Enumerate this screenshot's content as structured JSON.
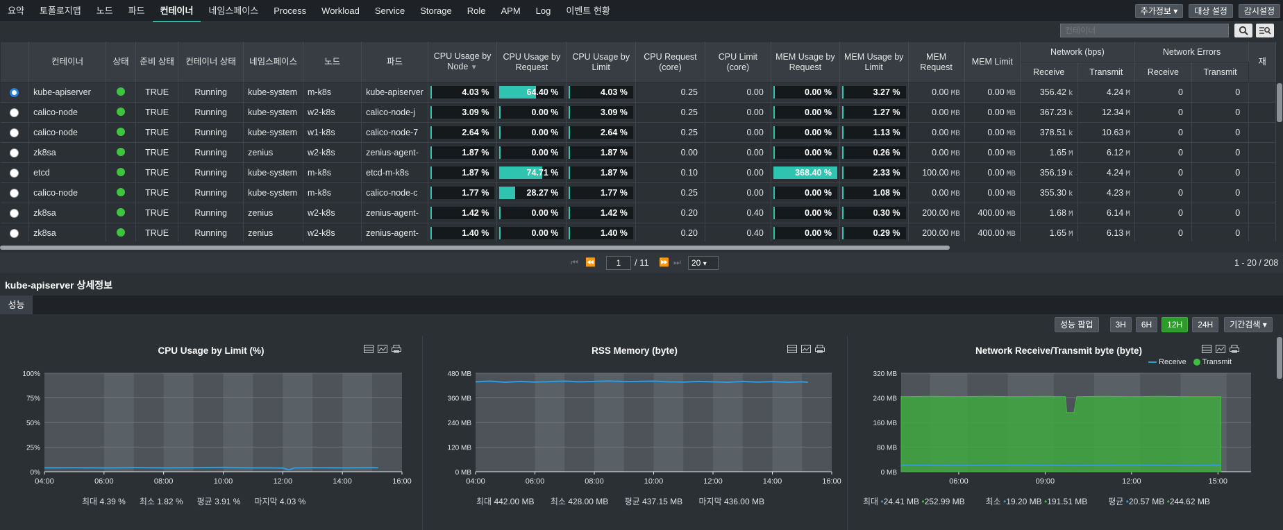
{
  "nav": {
    "tabs": [
      "요약",
      "토폴로지맵",
      "노드",
      "파드",
      "컨테이너",
      "네임스페이스",
      "Process",
      "Workload",
      "Service",
      "Storage",
      "Role",
      "APM",
      "Log",
      "이벤트 현황"
    ],
    "active": "컨테이너",
    "more_info": "추가정보",
    "target_settings": "대상 설정",
    "monitor_settings": "감시설정"
  },
  "search": {
    "placeholder": "컨테이너"
  },
  "table": {
    "headers": {
      "container": "컨테이너",
      "status": "상태",
      "ready": "준비 상태",
      "container_status": "컨테이너 상태",
      "namespace": "네임스페이스",
      "node": "노드",
      "pod": "파드",
      "cpu_node": "CPU Usage by Node",
      "cpu_req": "CPU Usage by Request",
      "cpu_limit": "CPU Usage by Limit",
      "cpu_request_core": "CPU Request (core)",
      "cpu_limit_core": "CPU Limit (core)",
      "mem_req": "MEM Usage by Request",
      "mem_limit": "MEM Usage by Limit",
      "mem_request": "MEM Request",
      "mem_limit2": "MEM Limit",
      "network": "Network (bps)",
      "network_errors": "Network Errors",
      "receive": "Receive",
      "transmit": "Transmit",
      "cut": "재"
    },
    "rows": [
      {
        "name": "kube-apiserver",
        "ready": "TRUE",
        "state": "Running",
        "ns": "kube-system",
        "node": "m-k8s",
        "pod": "kube-apiserver",
        "cpu_node": 4.03,
        "cpu_node_t": "4.03 %",
        "cpu_req": 64.4,
        "cpu_req_t": "64.40 %",
        "cpu_lim": 4.03,
        "cpu_lim_t": "4.03 %",
        "cpu_req_core": "0.25",
        "cpu_lim_core": "0.00",
        "mem_req": 0,
        "mem_req_t": "0.00 %",
        "mem_lim": 3.27,
        "mem_lim_t": "3.27 %",
        "mem_request": "0.00",
        "mem_limit": "0.00",
        "rx": "356.42",
        "rx_u": "k",
        "tx": "4.24",
        "tx_u": "M",
        "err_rx": "0",
        "err_tx": "0",
        "selected": true
      },
      {
        "name": "calico-node",
        "ready": "TRUE",
        "state": "Running",
        "ns": "kube-system",
        "node": "w2-k8s",
        "pod": "calico-node-j",
        "cpu_node": 3.09,
        "cpu_node_t": "3.09 %",
        "cpu_req": 0,
        "cpu_req_t": "0.00 %",
        "cpu_lim": 3.09,
        "cpu_lim_t": "3.09 %",
        "cpu_req_core": "0.25",
        "cpu_lim_core": "0.00",
        "mem_req": 0,
        "mem_req_t": "0.00 %",
        "mem_lim": 1.27,
        "mem_lim_t": "1.27 %",
        "mem_request": "0.00",
        "mem_limit": "0.00",
        "rx": "367.23",
        "rx_u": "k",
        "tx": "12.34",
        "tx_u": "M",
        "err_rx": "0",
        "err_tx": "0"
      },
      {
        "name": "calico-node",
        "ready": "TRUE",
        "state": "Running",
        "ns": "kube-system",
        "node": "w1-k8s",
        "pod": "calico-node-7",
        "cpu_node": 2.64,
        "cpu_node_t": "2.64 %",
        "cpu_req": 0,
        "cpu_req_t": "0.00 %",
        "cpu_lim": 2.64,
        "cpu_lim_t": "2.64 %",
        "cpu_req_core": "0.25",
        "cpu_lim_core": "0.00",
        "mem_req": 0,
        "mem_req_t": "0.00 %",
        "mem_lim": 1.13,
        "mem_lim_t": "1.13 %",
        "mem_request": "0.00",
        "mem_limit": "0.00",
        "rx": "378.51",
        "rx_u": "k",
        "tx": "10.63",
        "tx_u": "M",
        "err_rx": "0",
        "err_tx": "0"
      },
      {
        "name": "zk8sa",
        "ready": "TRUE",
        "state": "Running",
        "ns": "zenius",
        "node": "w2-k8s",
        "pod": "zenius-agent-",
        "cpu_node": 1.87,
        "cpu_node_t": "1.87 %",
        "cpu_req": 0,
        "cpu_req_t": "0.00 %",
        "cpu_lim": 1.87,
        "cpu_lim_t": "1.87 %",
        "cpu_req_core": "0.00",
        "cpu_lim_core": "0.00",
        "mem_req": 0,
        "mem_req_t": "0.00 %",
        "mem_lim": 0.26,
        "mem_lim_t": "0.26 %",
        "mem_request": "0.00",
        "mem_limit": "0.00",
        "rx": "1.65",
        "rx_u": "M",
        "tx": "6.12",
        "tx_u": "M",
        "err_rx": "0",
        "err_tx": "0"
      },
      {
        "name": "etcd",
        "ready": "TRUE",
        "state": "Running",
        "ns": "kube-system",
        "node": "m-k8s",
        "pod": "etcd-m-k8s",
        "cpu_node": 1.87,
        "cpu_node_t": "1.87 %",
        "cpu_req": 74.71,
        "cpu_req_t": "74.71 %",
        "cpu_lim": 1.87,
        "cpu_lim_t": "1.87 %",
        "cpu_req_core": "0.10",
        "cpu_lim_core": "0.00",
        "mem_req": 100,
        "mem_req_t": "368.40 %",
        "mem_lim": 2.33,
        "mem_lim_t": "2.33 %",
        "mem_request": "100.00",
        "mem_limit": "0.00",
        "rx": "356.19",
        "rx_u": "k",
        "tx": "4.24",
        "tx_u": "M",
        "err_rx": "0",
        "err_tx": "0"
      },
      {
        "name": "calico-node",
        "ready": "TRUE",
        "state": "Running",
        "ns": "kube-system",
        "node": "m-k8s",
        "pod": "calico-node-c",
        "cpu_node": 1.77,
        "cpu_node_t": "1.77 %",
        "cpu_req": 28.27,
        "cpu_req_t": "28.27 %",
        "cpu_lim": 1.77,
        "cpu_lim_t": "1.77 %",
        "cpu_req_core": "0.25",
        "cpu_lim_core": "0.00",
        "mem_req": 0,
        "mem_req_t": "0.00 %",
        "mem_lim": 1.08,
        "mem_lim_t": "1.08 %",
        "mem_request": "0.00",
        "mem_limit": "0.00",
        "rx": "355.30",
        "rx_u": "k",
        "tx": "4.23",
        "tx_u": "M",
        "err_rx": "0",
        "err_tx": "0"
      },
      {
        "name": "zk8sa",
        "ready": "TRUE",
        "state": "Running",
        "ns": "zenius",
        "node": "w2-k8s",
        "pod": "zenius-agent-",
        "cpu_node": 1.42,
        "cpu_node_t": "1.42 %",
        "cpu_req": 0,
        "cpu_req_t": "0.00 %",
        "cpu_lim": 1.42,
        "cpu_lim_t": "1.42 %",
        "cpu_req_core": "0.20",
        "cpu_lim_core": "0.40",
        "mem_req": 0,
        "mem_req_t": "0.00 %",
        "mem_lim": 0.3,
        "mem_lim_t": "0.30 %",
        "mem_request": "200.00",
        "mem_limit": "400.00",
        "rx": "1.68",
        "rx_u": "M",
        "tx": "6.14",
        "tx_u": "M",
        "err_rx": "0",
        "err_tx": "0"
      },
      {
        "name": "zk8sa",
        "ready": "TRUE",
        "state": "Running",
        "ns": "zenius",
        "node": "w2-k8s",
        "pod": "zenius-agent-",
        "cpu_node": 1.4,
        "cpu_node_t": "1.40 %",
        "cpu_req": 0,
        "cpu_req_t": "0.00 %",
        "cpu_lim": 1.4,
        "cpu_lim_t": "1.40 %",
        "cpu_req_core": "0.20",
        "cpu_lim_core": "0.40",
        "mem_req": 0,
        "mem_req_t": "0.00 %",
        "mem_lim": 0.29,
        "mem_lim_t": "0.29 %",
        "mem_request": "200.00",
        "mem_limit": "400.00",
        "rx": "1.65",
        "rx_u": "M",
        "tx": "6.13",
        "tx_u": "M",
        "err_rx": "0",
        "err_tx": "0"
      }
    ],
    "mb_unit": "MB",
    "status_color": "#3ec43e",
    "bar_color": "#2ec4b0"
  },
  "pager": {
    "page": "1",
    "total": "/ 11",
    "size": "20",
    "count": "1 - 20 / 208"
  },
  "detail": {
    "title": "kube-apiserver 상세정보",
    "tab": "성능",
    "popup": "성능 팝업",
    "ranges": [
      "3H",
      "6H",
      "12H",
      "24H"
    ],
    "active_range": "12H",
    "period_search": "기간검색"
  },
  "chart_data": [
    {
      "type": "line",
      "title": "CPU Usage by Limit (%)",
      "x_ticks": [
        "04:00",
        "06:00",
        "08:00",
        "10:00",
        "12:00",
        "14:00",
        "16:00"
      ],
      "y_ticks": [
        "0%",
        "25%",
        "50%",
        "75%",
        "100%"
      ],
      "ylim": [
        0,
        100
      ],
      "series": [
        {
          "color": "#2f9be0",
          "x": [
            4.0,
            5.0,
            6.0,
            7.0,
            8.0,
            9.0,
            10.0,
            11.0,
            12.0,
            12.2,
            12.4,
            13.0,
            14.0,
            15.0,
            15.2
          ],
          "y": [
            4.0,
            4.1,
            3.9,
            4.2,
            4.0,
            4.1,
            4.3,
            4.0,
            3.8,
            1.9,
            3.9,
            4.1,
            4.0,
            4.2,
            4.03
          ]
        }
      ],
      "stats": {
        "max_label": "최대",
        "max": "4.39 %",
        "min_label": "최소",
        "min": "1.82 %",
        "avg_label": "평균",
        "avg": "3.91 %",
        "last_label": "마지막",
        "last": "4.03 %"
      }
    },
    {
      "type": "line",
      "title": "RSS Memory (byte)",
      "x_ticks": [
        "04:00",
        "06:00",
        "08:00",
        "10:00",
        "12:00",
        "14:00",
        "16:00"
      ],
      "y_ticks": [
        "0 MB",
        "120 MB",
        "240 MB",
        "360 MB",
        "480 MB"
      ],
      "ylim": [
        0,
        480
      ],
      "series": [
        {
          "color": "#2f9be0",
          "x": [
            4.0,
            4.5,
            5.0,
            5.5,
            6.0,
            6.5,
            7.0,
            7.5,
            8.0,
            8.5,
            9.0,
            9.5,
            10.0,
            10.5,
            11.0,
            11.5,
            12.0,
            12.5,
            13.0,
            13.5,
            14.0,
            14.5,
            15.0,
            15.2
          ],
          "y": [
            438,
            441,
            436,
            440,
            437,
            439,
            441,
            438,
            440,
            442,
            439,
            440,
            441,
            438,
            437,
            440,
            438,
            436,
            440,
            437,
            439,
            436,
            438,
            436
          ]
        }
      ],
      "stats": {
        "max_label": "최대",
        "max": "442.00 MB",
        "min_label": "최소",
        "min": "428.00 MB",
        "avg_label": "평균",
        "avg": "437.15 MB",
        "last_label": "마지막",
        "last": "436.00 MB"
      }
    },
    {
      "type": "area",
      "title": "Network Receive/Transmit byte (byte)",
      "x_ticks": [
        "06:00",
        "09:00",
        "12:00",
        "15:00"
      ],
      "y_ticks": [
        "0 MB",
        "80 MB",
        "160 MB",
        "240 MB",
        "320 MB"
      ],
      "ylim": [
        0,
        320
      ],
      "legend": [
        "Receive",
        "Transmit"
      ],
      "series": [
        {
          "name": "Transmit",
          "color": "#3fbf3f",
          "x": [
            4.0,
            5.0,
            6.0,
            7.0,
            8.0,
            9.0,
            9.7,
            9.75,
            10.0,
            10.1,
            11.0,
            12.0,
            13.0,
            14.0,
            15.0,
            15.1
          ],
          "y": [
            244,
            245,
            244,
            245,
            244,
            245,
            244,
            192,
            192,
            244,
            245,
            244,
            245,
            244,
            244,
            244
          ]
        },
        {
          "name": "Receive",
          "color": "#2f9be0",
          "x": [
            4.0,
            6.0,
            8.0,
            10.0,
            12.0,
            14.0,
            15.1
          ],
          "y": [
            21,
            20,
            21,
            20,
            21,
            20,
            21
          ]
        }
      ],
      "stats": {
        "max_label": "최대",
        "max_rx": "24.41 MB",
        "max_tx": "252.99 MB",
        "min_label": "최소",
        "min_rx": "19.20 MB",
        "min_tx": "191.51 MB",
        "avg_label": "평균",
        "avg_rx": "20.57 MB",
        "avg_tx": "244.62 MB"
      }
    }
  ]
}
